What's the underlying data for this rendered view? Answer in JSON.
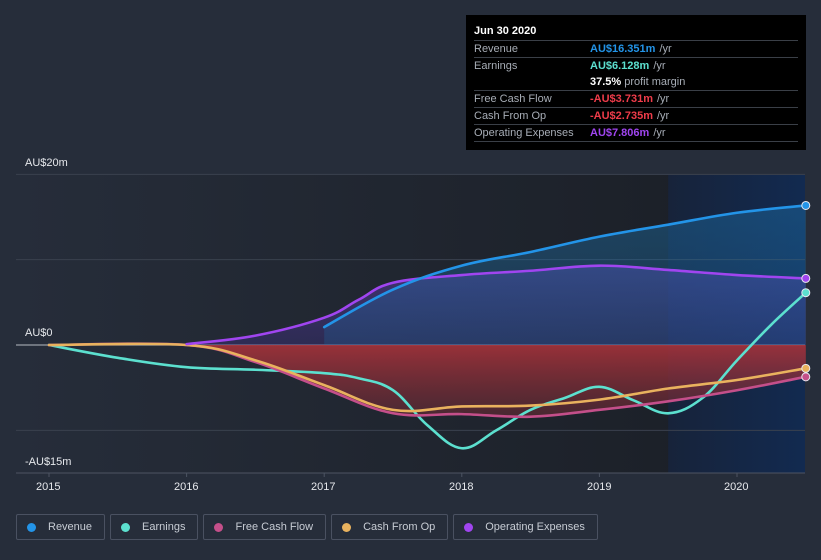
{
  "tooltip": {
    "date": "Jun 30 2020",
    "rows": [
      {
        "label": "Revenue",
        "value": "AU$16.351m",
        "unit": "/yr",
        "color": "#2394e8"
      },
      {
        "label": "Earnings",
        "value": "AU$6.128m",
        "unit": "/yr",
        "color": "#5ce0cf"
      },
      {
        "label": "",
        "value": "37.5%",
        "unit": "profit margin",
        "color": "#ffffff"
      },
      {
        "label": "Free Cash Flow",
        "value": "-AU$3.731m",
        "unit": "/yr",
        "color": "#ef3c4a"
      },
      {
        "label": "Cash From Op",
        "value": "-AU$2.735m",
        "unit": "/yr",
        "color": "#ef3c4a"
      },
      {
        "label": "Operating Expenses",
        "value": "AU$7.806m",
        "unit": "/yr",
        "color": "#a045f0"
      }
    ]
  },
  "legend": [
    {
      "label": "Revenue",
      "color": "#2394e8"
    },
    {
      "label": "Earnings",
      "color": "#5ce0cf"
    },
    {
      "label": "Free Cash Flow",
      "color": "#c44f8a"
    },
    {
      "label": "Cash From Op",
      "color": "#e9b25e"
    },
    {
      "label": "Operating Expenses",
      "color": "#a045f0"
    }
  ],
  "chart_data": {
    "type": "line",
    "title": "",
    "xlabel": "",
    "ylabel": "",
    "xlim": [
      2014.7,
      2020.5
    ],
    "ylim": [
      -15,
      20
    ],
    "y_ticks": [
      {
        "value": 20,
        "label": "AU$20m"
      },
      {
        "value": 0,
        "label": "AU$0"
      },
      {
        "value": -15,
        "label": "-AU$15m"
      }
    ],
    "x_ticks": [
      {
        "value": 2015,
        "label": "2015"
      },
      {
        "value": 2016,
        "label": "2016"
      },
      {
        "value": 2017,
        "label": "2017"
      },
      {
        "value": 2018,
        "label": "2018"
      },
      {
        "value": 2019,
        "label": "2019"
      },
      {
        "value": 2020,
        "label": "2020"
      }
    ],
    "highlight_from": 2019.5,
    "grid": true,
    "legend_position": "bottom-left",
    "series": [
      {
        "name": "Revenue",
        "color": "#2394e8",
        "x": [
          2017.0,
          2017.5,
          2018.0,
          2018.5,
          2019.0,
          2019.5,
          2020.0,
          2020.5
        ],
        "values": [
          2.1,
          6.5,
          9.3,
          10.9,
          12.7,
          14.1,
          15.5,
          16.351
        ]
      },
      {
        "name": "Operating Expenses",
        "color": "#a045f0",
        "x": [
          2016.0,
          2016.5,
          2017.0,
          2017.25,
          2017.5,
          2018.0,
          2018.5,
          2019.0,
          2019.5,
          2020.0,
          2020.5
        ],
        "values": [
          0.1,
          1.1,
          3.2,
          5.3,
          7.3,
          8.2,
          8.7,
          9.3,
          8.8,
          8.2,
          7.806
        ]
      },
      {
        "name": "Earnings",
        "color": "#5ce0cf",
        "x": [
          2015.0,
          2015.5,
          2016.0,
          2016.5,
          2017.0,
          2017.25,
          2017.5,
          2017.75,
          2018.0,
          2018.25,
          2018.5,
          2018.75,
          2019.0,
          2019.25,
          2019.5,
          2019.75,
          2020.0,
          2020.25,
          2020.5
        ],
        "values": [
          0,
          -1.5,
          -2.6,
          -2.9,
          -3.3,
          -3.9,
          -5.3,
          -9.4,
          -12.1,
          -10.0,
          -7.6,
          -6.2,
          -4.9,
          -6.5,
          -8.0,
          -6.2,
          -1.8,
          2.4,
          6.128
        ]
      },
      {
        "name": "Free Cash Flow",
        "color": "#c44f8a",
        "x": [
          2015.0,
          2016.0,
          2016.5,
          2017.0,
          2017.5,
          2018.0,
          2018.5,
          2019.0,
          2019.5,
          2020.0,
          2020.5
        ],
        "values": [
          0,
          0,
          -2.0,
          -5.1,
          -8.0,
          -8.1,
          -8.4,
          -7.6,
          -6.6,
          -5.3,
          -3.731
        ]
      },
      {
        "name": "Cash From Op",
        "color": "#e9b25e",
        "x": [
          2015.0,
          2016.0,
          2016.5,
          2017.0,
          2017.5,
          2018.0,
          2018.5,
          2019.0,
          2019.5,
          2020.0,
          2020.5
        ],
        "values": [
          0,
          0,
          -1.8,
          -4.7,
          -7.6,
          -7.2,
          -7.1,
          -6.4,
          -5.1,
          -4.1,
          -2.735
        ]
      }
    ]
  }
}
